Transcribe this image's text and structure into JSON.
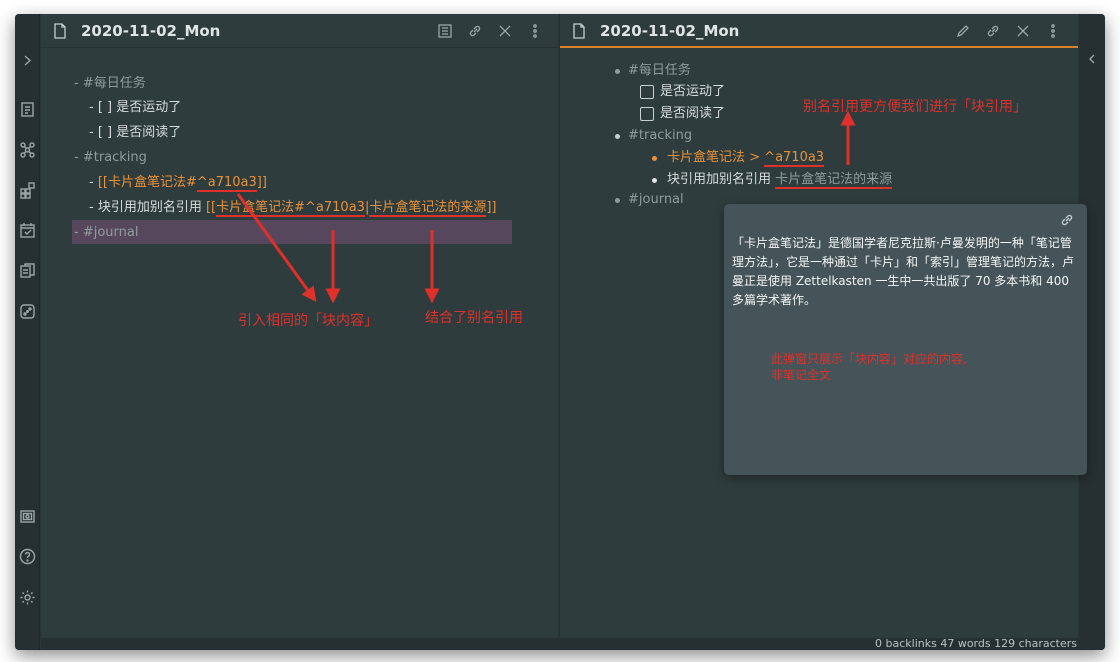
{
  "colors": {
    "accent": "#e8923a",
    "annotation": "#e0302b",
    "background": "#2f3c3d",
    "popover": "#455459",
    "highlight": "#56475d"
  },
  "ribbon": {
    "icons": [
      "expand-icon",
      "open-file-icon",
      "graph-icon",
      "grid-icon",
      "calendar-icon",
      "copy-icon",
      "dice-icon",
      "vault-icon",
      "help-icon",
      "settings-icon"
    ],
    "expand_glyph": "›"
  },
  "left_pane": {
    "title": "2020-11-02_Mon",
    "header_icons": [
      "reading-view-icon",
      "link-icon",
      "close-icon",
      "more-options-icon"
    ],
    "lines": {
      "l1": "- #每日任务",
      "l2": "- [ ] 是否运动了",
      "l3": "- [ ] 是否阅读了",
      "l4": "- #tracking",
      "l5_prefix": "- ",
      "l5_link_a": "[[卡片盒笔记法#",
      "l5_link_b": "^a710a3",
      "l5_link_c": "]]",
      "l6_prefix": "- 块引用加别名引用 ",
      "l6_link_a": "[[",
      "l6_link_b": "卡片盒笔记法#^a710a3",
      "l6_link_c": "|",
      "l6_link_d": "卡片盒笔记法的来源",
      "l6_link_e": "]]",
      "l7": "- #journal"
    }
  },
  "right_pane": {
    "title": "2020-11-02_Mon",
    "header_icons": [
      "edit-icon",
      "link-icon",
      "close-icon",
      "more-options-icon"
    ],
    "items": {
      "tag1": "#每日任务",
      "task1": "是否运动了",
      "task2": "是否阅读了",
      "tag2": "#tracking",
      "ref1_a": "卡片盒笔记法 > ",
      "ref1_b": "^a710a3",
      "ref2_a": "块引用加别名引用 ",
      "ref2_b": "卡片盒笔记法的来源",
      "tag3": "#journal"
    },
    "popover": {
      "text": "「卡片盒笔记法」是德国学者尼克拉斯·卢曼发明的一种「笔记管理方法」，它是一种通过「卡片」和「索引」管理笔记的方法，卢曼正是使用 Zettelkasten 一生中一共出版了 70 多本书和 400 多篇学术著作。"
    }
  },
  "annotations": {
    "a1": "别名引用更方便我们进行「块引用」",
    "a2": "引入相同的「块内容」",
    "a3": "结合了别名引用",
    "a4_line1": "此弹窗只展示「块内容」对应的内容,",
    "a4_line2": "非笔记全文"
  },
  "status_bar": {
    "text": "0 backlinks     47 words   129 characters"
  }
}
